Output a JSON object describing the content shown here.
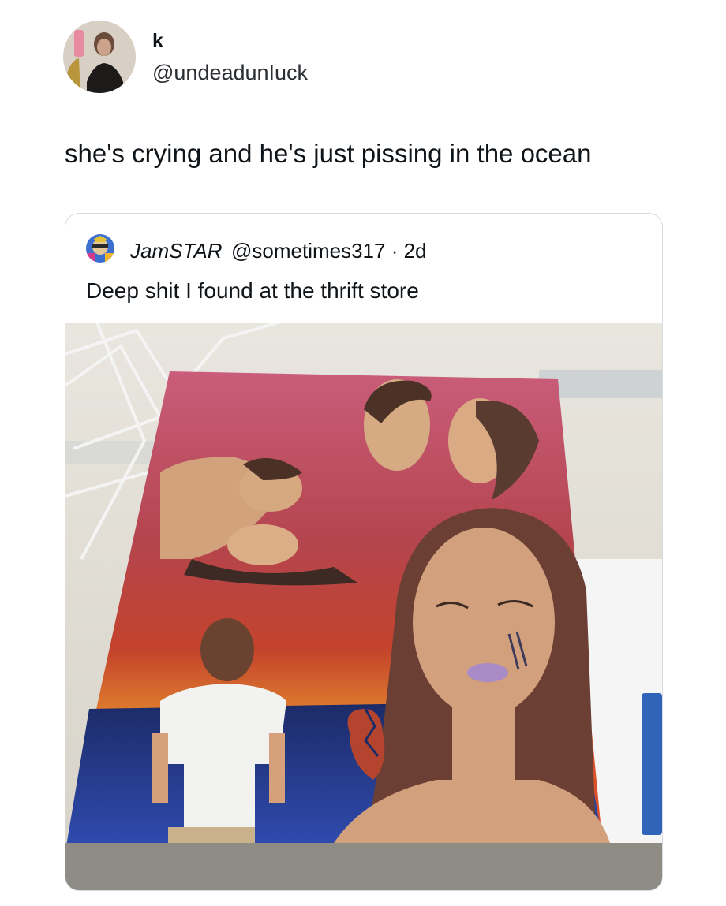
{
  "tweet": {
    "author": {
      "display_name": "k",
      "handle": "@undeadunIuck"
    },
    "text": "she's crying and he's just pissing in the ocean"
  },
  "quoted_tweet": {
    "author": {
      "display_name": "JamSTAR",
      "handle": "@sometimes317",
      "time": "· 2d"
    },
    "text": "Deep shit I found at the thrift store",
    "media": {
      "description": "painting-photo"
    }
  },
  "colors": {
    "text": "#0f1419",
    "border": "#d7dbdf",
    "background": "#ffffff"
  }
}
